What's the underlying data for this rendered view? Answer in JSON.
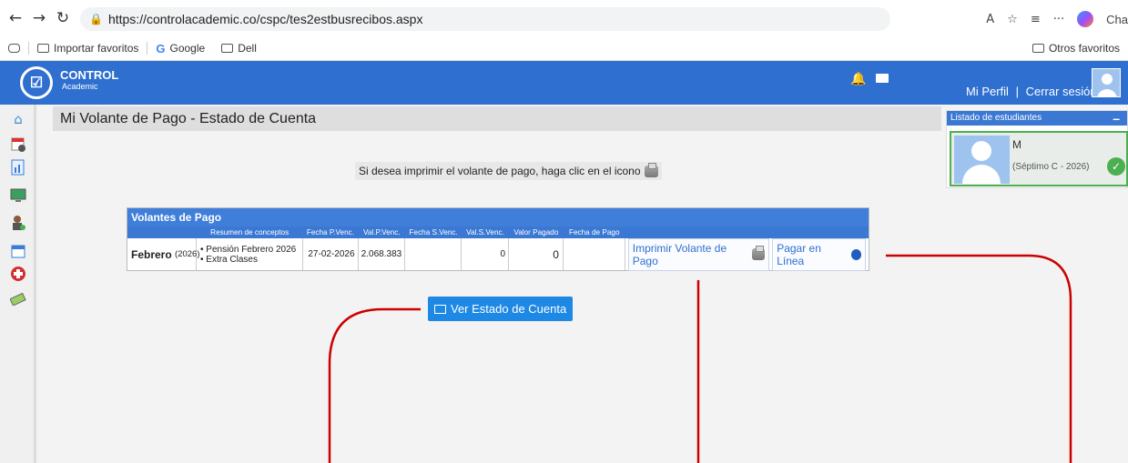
{
  "browser": {
    "url": "https://controlacademic.co/cspc/tes2estbusrecibos.aspx",
    "bookmarks": [
      "Importar favoritos",
      "Google",
      "Dell"
    ],
    "other_favorites": "Otros favoritos",
    "copilot_label": "Cha"
  },
  "header": {
    "logo_title": "CONTROL",
    "logo_subtitle": "Academic",
    "profile_link": "Mi Perfil",
    "separator": "|",
    "logout_link": "Cerrar sesión"
  },
  "page": {
    "title": "Mi Volante de Pago - Estado de Cuenta",
    "print_note": "Si desea imprimir el volante de pago, haga clic en el icono"
  },
  "volantes": {
    "heading": "Volantes de Pago",
    "columns": [
      "",
      "Resumen de conceptos",
      "Fecha P.Venc.",
      "Val.P.Venc.",
      "Fecha S.Venc.",
      "Val.S.Venc.",
      "Valor Pagado",
      "Fecha de Pago",
      ""
    ],
    "rows": [
      {
        "month": "Febrero",
        "year": "(2026)",
        "concepts": [
          "• Pensión Febrero 2026",
          "• Extra Clases"
        ],
        "fecha_p_venc": "27-02-2026",
        "val_p_venc": "2.068.383",
        "fecha_s_venc": "",
        "val_s_venc": "0",
        "valor_pagado": "0",
        "fecha_pago": "",
        "print_label": "Imprimir Volante de Pago",
        "pay_label": "Pagar en Línea"
      }
    ]
  },
  "estado_button": "Ver Estado de Cuenta",
  "students": {
    "heading": "Listado de estudiantes",
    "collapse": "–",
    "items": [
      {
        "name": "M",
        "grade": "(Séptimo C - 2026)"
      }
    ]
  },
  "colors": {
    "header_blue": "#2f6fd0",
    "table_blue": "#3f7ed9",
    "button_blue": "#1e88e5",
    "selected_green": "#4caf50",
    "annotation_red": "#cc0000"
  }
}
